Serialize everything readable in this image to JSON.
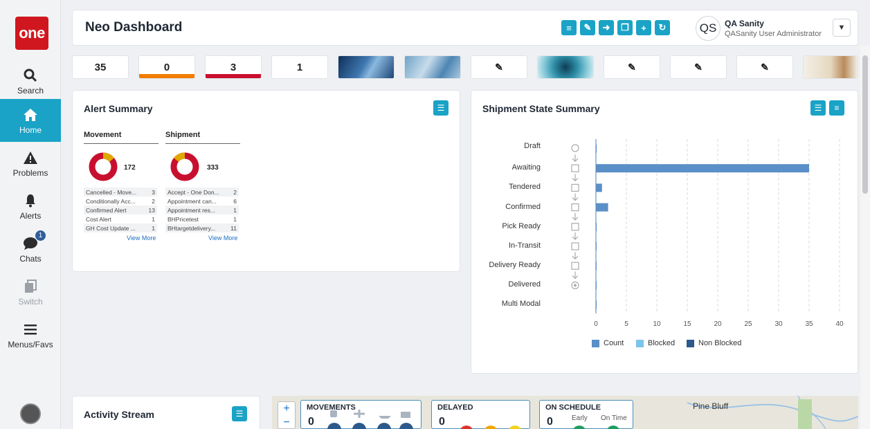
{
  "logo": "one",
  "nav": {
    "search": "Search",
    "home": "Home",
    "problems": "Problems",
    "alerts": "Alerts",
    "chats": "Chats",
    "chats_badge": "1",
    "switch": "Switch",
    "menus": "Menus/Favs"
  },
  "header": {
    "title": "Neo Dashboard",
    "user_initials": "QS",
    "user_name": "QA Sanity",
    "user_role": "QASanity User Administrator"
  },
  "tiles": [
    {
      "value": "35",
      "bar_color": ""
    },
    {
      "value": "0",
      "bar_color": "#f07d00"
    },
    {
      "value": "3",
      "bar_color": "#c8102e"
    },
    {
      "value": "1",
      "bar_color": ""
    }
  ],
  "alert_summary": {
    "title": "Alert Summary",
    "movement": {
      "heading": "Movement",
      "total": "172",
      "rows": [
        {
          "label": "Cancelled - Move...",
          "count": "3"
        },
        {
          "label": "Conditionally Acc...",
          "count": "2"
        },
        {
          "label": "Confirmed Alert",
          "count": "13"
        },
        {
          "label": "Cost Alert",
          "count": "1"
        },
        {
          "label": "GH Cost Update ...",
          "count": "1"
        }
      ]
    },
    "shipment": {
      "heading": "Shipment",
      "total": "333",
      "rows": [
        {
          "label": "Accept - One Don...",
          "count": "2"
        },
        {
          "label": "Appointment can...",
          "count": "6"
        },
        {
          "label": "Appointment res...",
          "count": "1"
        },
        {
          "label": "BHPricetest",
          "count": "1"
        },
        {
          "label": "BHtargetdelivery...",
          "count": "11"
        }
      ]
    },
    "view_more": "View More"
  },
  "shipment_state": {
    "title": "Shipment State Summary"
  },
  "chart_data": {
    "type": "bar",
    "orientation": "horizontal",
    "categories": [
      "Draft",
      "Awaiting",
      "Tendered",
      "Confirmed",
      "Pick Ready",
      "In-Transit",
      "Delivery Ready",
      "Delivered",
      "Multi Modal"
    ],
    "series": [
      {
        "name": "Count",
        "values": [
          0,
          35,
          1,
          2,
          0,
          0,
          0,
          0,
          0
        ],
        "color": "#5b8fc7"
      },
      {
        "name": "Blocked",
        "values": [],
        "color": "#7cc4ea"
      },
      {
        "name": "Non Blocked",
        "values": [],
        "color": "#2c5a8c"
      }
    ],
    "xlim": [
      0,
      40
    ],
    "xticks": [
      "0",
      "5",
      "10",
      "15",
      "20",
      "25",
      "30",
      "35",
      "40"
    ],
    "grid": true,
    "legend": "bottom"
  },
  "activity": {
    "title": "Activity Stream"
  },
  "map": {
    "movements_title": "MOVEMENTS",
    "movements_value": "0",
    "delayed_title": "DELAYED",
    "delayed_value": "0",
    "onschedule_title": "ON SCHEDULE",
    "onschedule_value": "0",
    "early": "Early",
    "ontime": "On Time",
    "place": "Pine Bluff",
    "zoom_in": "+",
    "zoom_out": "−"
  },
  "colors": {
    "accent": "#1aa3c6",
    "donut_red": "#c8102e",
    "donut_yellow": "#e0a800",
    "bar": "#5b8fc7"
  }
}
